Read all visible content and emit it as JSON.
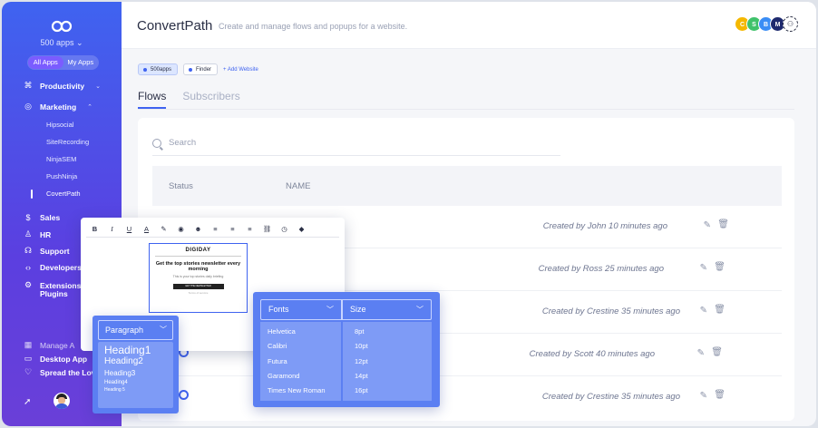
{
  "sidebar": {
    "apps_count": "500 apps",
    "toggle": [
      "All Apps",
      "My Apps"
    ],
    "nav": [
      {
        "label": "Productivity",
        "icon": "command-icon"
      },
      {
        "label": "Marketing",
        "icon": "target-icon"
      },
      {
        "label": "Sales",
        "icon": "dollar-icon"
      },
      {
        "label": "HR",
        "icon": "person-icon"
      },
      {
        "label": "Support",
        "icon": "headset-icon"
      },
      {
        "label": "Developers",
        "icon": "code-icon"
      },
      {
        "label": "Extensions",
        "icon": "gear-icon"
      },
      {
        "label": "Plugins"
      }
    ],
    "marketing_subitems": [
      "Hipsocial",
      "SiteRecording",
      "NinjaSEM",
      "PushNinja",
      "CovertPath"
    ],
    "bottom": [
      {
        "label": "Manage A",
        "icon": "grid-icon"
      },
      {
        "label": "Desktop App",
        "icon": "monitor-icon"
      },
      {
        "label": "Spread the Lov",
        "icon": "heart-icon"
      }
    ]
  },
  "header": {
    "title": "ConvertPath",
    "subtitle": "Create and manage flows and popups for a website.",
    "avatars": [
      {
        "letter": "C",
        "color": "#f5b800"
      },
      {
        "letter": "S",
        "color": "#3fc26b"
      },
      {
        "letter": "B",
        "color": "#3a8df5"
      },
      {
        "letter": "M",
        "color": "#1e2a6e"
      }
    ]
  },
  "filters": {
    "chips": [
      "500apps",
      "Finder"
    ],
    "add_website": "+ Add Website"
  },
  "tabs": [
    "Flows",
    "Subscribers"
  ],
  "search": {
    "placeholder": "Search"
  },
  "table": {
    "headers": [
      "Status",
      "NAME"
    ],
    "rows": [
      {
        "created": "Created by John 10 minutes ago"
      },
      {
        "created": "Created by Ross 25 minutes ago"
      },
      {
        "created": "Created by Crestine 35 minutes ago"
      },
      {
        "created": "Created by Scott 40 minutes ago"
      },
      {
        "created": "Created by Crestine 35 minutes ago"
      }
    ]
  },
  "editor": {
    "toolbar": [
      "B",
      "I",
      "U",
      "A",
      "✎",
      "◉",
      "☻",
      "≡",
      "≡",
      "≡",
      "⛓",
      "◷",
      "◆"
    ],
    "newsletter": {
      "logo": "DIGIDAY",
      "heading": "Get the top stories newsletter every morning",
      "sub": "This is your top stories daily briefing",
      "input": "GET THE NEWSLETTER",
      "foot": "Terms of service"
    }
  },
  "paragraph_menu": {
    "selected": "Paragraph",
    "options": [
      "Heading1",
      "Heading2",
      "Heading3",
      "Heading4",
      "Heading 5"
    ]
  },
  "font_menu": {
    "fonts_label": "Fonts",
    "size_label": "Size",
    "fonts": [
      "Helvetica",
      "Calibri",
      "Futura",
      "Garamond",
      "Times New Roman"
    ],
    "sizes": [
      "8pt",
      "10pt",
      "12pt",
      "14pt",
      "16pt"
    ]
  }
}
